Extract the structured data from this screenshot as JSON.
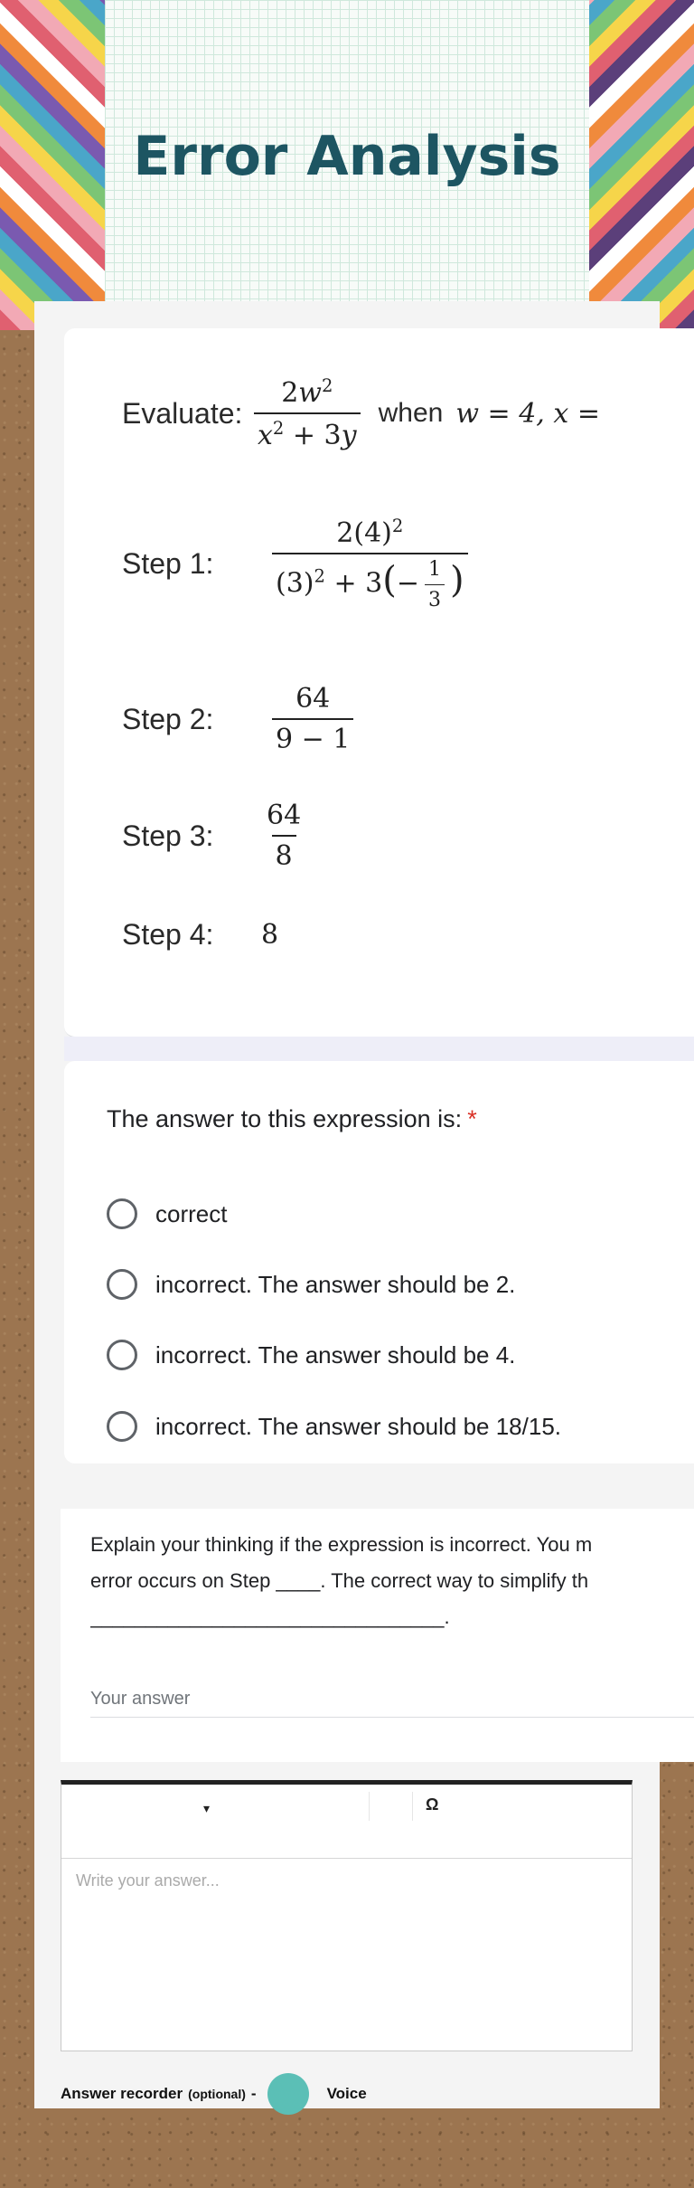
{
  "header": {
    "title": "Error Analysis"
  },
  "math": {
    "evaluate_label": "Evaluate:",
    "when_text": "when",
    "condition": "w = 4,  x =",
    "steps": [
      {
        "label": "Step 1:"
      },
      {
        "label": "Step 2:",
        "numerator": "64",
        "denominator": "9 − 1"
      },
      {
        "label": "Step 3:",
        "numerator": "64",
        "denominator": "8"
      },
      {
        "label": "Step 4:",
        "value": "8"
      }
    ]
  },
  "question": {
    "text": "The answer to this expression is:",
    "required_marker": "*",
    "options": [
      "correct",
      "incorrect. The answer should be 2.",
      "incorrect. The answer should be 4.",
      "incorrect. The answer should be 18/15."
    ]
  },
  "open_question": {
    "line1": "Explain your thinking if the expression is incorrect. You m",
    "line2": "error occurs on Step ____. The correct way to simplify th",
    "line3": "________________________________.",
    "placeholder": "Your answer"
  },
  "editor": {
    "caret": "▾",
    "omega": "Ω",
    "placeholder": "Write your answer..."
  },
  "recorder": {
    "label": "Answer recorder",
    "optional": "(optional)",
    "dash": "-",
    "voice": "Voice",
    "accent_color": "#5bbfb6"
  },
  "colors": {
    "title": "#1d5562",
    "required": "#d93025"
  }
}
